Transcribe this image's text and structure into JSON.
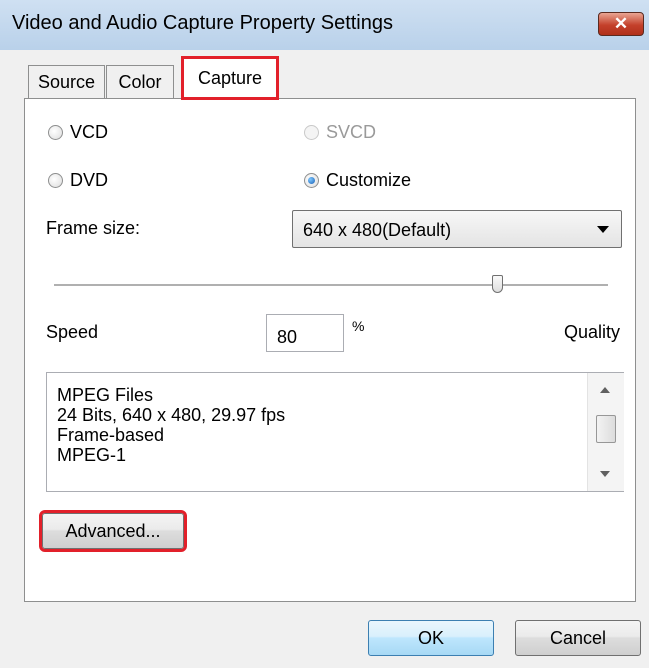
{
  "window": {
    "title": "Video and Audio Capture Property Settings",
    "close_glyph": "✕"
  },
  "tabs": [
    {
      "label": "Source"
    },
    {
      "label": "Color"
    },
    {
      "label": "Capture",
      "active": true
    }
  ],
  "format": {
    "options": [
      {
        "label": "VCD",
        "checked": false,
        "enabled": true
      },
      {
        "label": "SVCD",
        "checked": false,
        "enabled": false
      },
      {
        "label": "DVD",
        "checked": false,
        "enabled": true
      },
      {
        "label": "Customize",
        "checked": true,
        "enabled": true
      }
    ]
  },
  "frame_size": {
    "label": "Frame size:",
    "value": "640 x 480(Default)"
  },
  "speed_quality": {
    "speed_label": "Speed",
    "quality_label": "Quality",
    "value": "80",
    "unit": "%",
    "slider_fraction": 0.8
  },
  "info": {
    "lines": [
      "MPEG Files",
      "24 Bits, 640 x 480, 29.97 fps",
      "Frame-based",
      "MPEG-1"
    ]
  },
  "buttons": {
    "advanced": "Advanced...",
    "ok": "OK",
    "cancel": "Cancel"
  },
  "colors": {
    "highlight": "#e2202a",
    "titlebar": "#b9d1ea"
  }
}
